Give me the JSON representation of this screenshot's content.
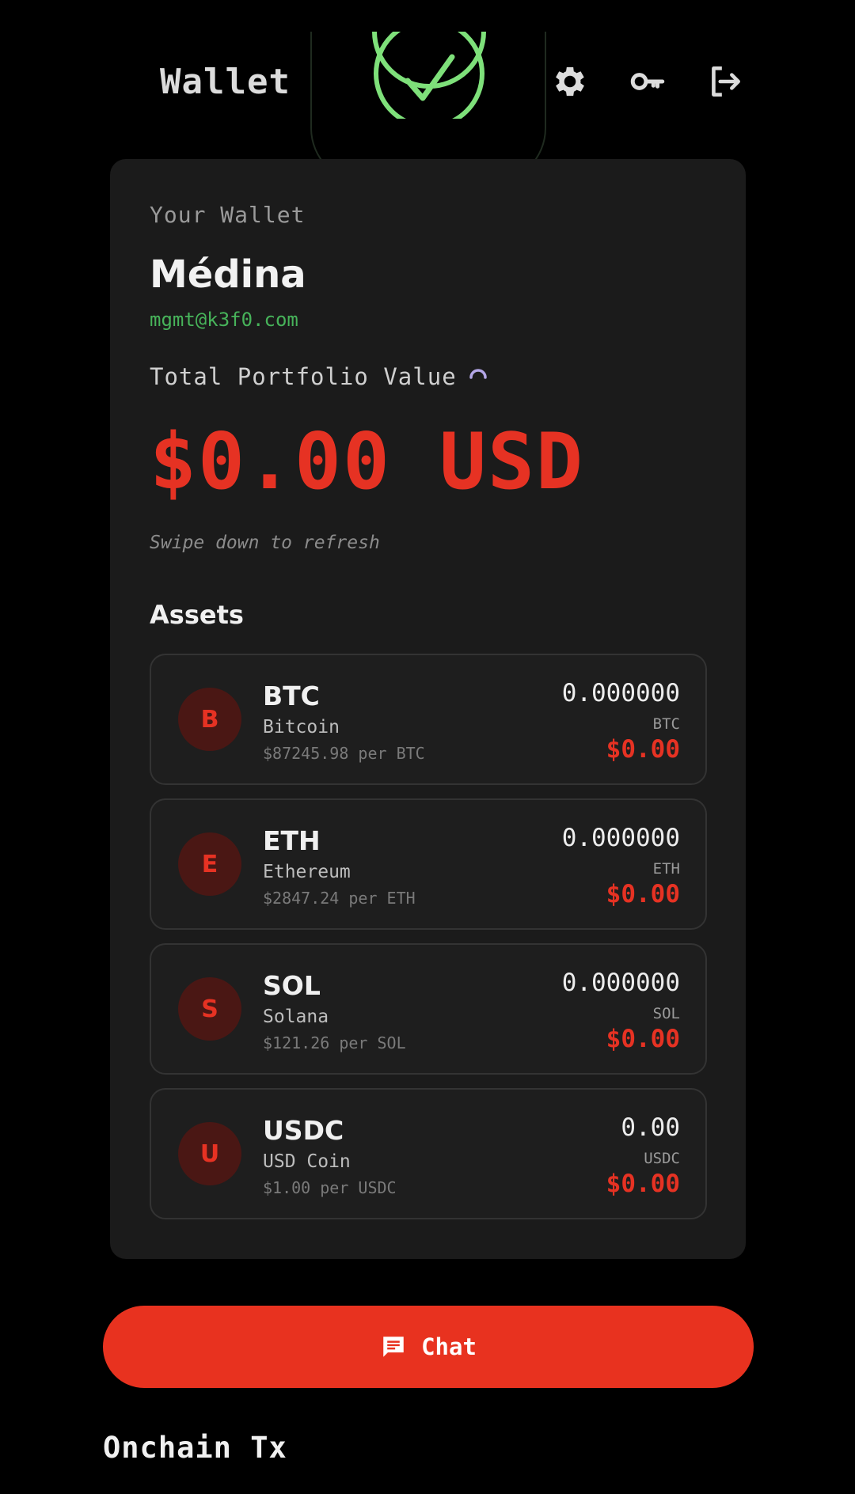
{
  "header": {
    "title": "Wallet",
    "status_icon": "check-circle-icon",
    "actions": [
      {
        "icon": "gear-icon"
      },
      {
        "icon": "key-icon"
      },
      {
        "icon": "logout-icon"
      }
    ]
  },
  "wallet": {
    "label": "Your Wallet",
    "name": "Médina",
    "email": "mgmt@k3f0.com",
    "portfolio_label": "Total Portfolio Value",
    "portfolio_value": "$0.00 USD",
    "refresh_hint": "Swipe down to refresh"
  },
  "assets": {
    "heading": "Assets",
    "items": [
      {
        "initial": "B",
        "symbol": "BTC",
        "name": "Bitcoin",
        "price": "$87245.98 per BTC",
        "amount": "0.000000",
        "unit": "BTC",
        "usd": "$0.00"
      },
      {
        "initial": "E",
        "symbol": "ETH",
        "name": "Ethereum",
        "price": "$2847.24 per ETH",
        "amount": "0.000000",
        "unit": "ETH",
        "usd": "$0.00"
      },
      {
        "initial": "S",
        "symbol": "SOL",
        "name": "Solana",
        "price": "$121.26 per SOL",
        "amount": "0.000000",
        "unit": "SOL",
        "usd": "$0.00"
      },
      {
        "initial": "U",
        "symbol": "USDC",
        "name": "USD Coin",
        "price": "$1.00 per USDC",
        "amount": "0.00",
        "unit": "USDC",
        "usd": "$0.00"
      }
    ]
  },
  "chat_button": {
    "label": "Chat",
    "icon": "chat-icon"
  },
  "onchain": {
    "heading": "Onchain Tx"
  },
  "colors": {
    "accent": "#e63223",
    "success": "#7ee07a",
    "email": "#47b35a",
    "card_bg": "#1b1b1b",
    "page_bg": "#000000"
  }
}
